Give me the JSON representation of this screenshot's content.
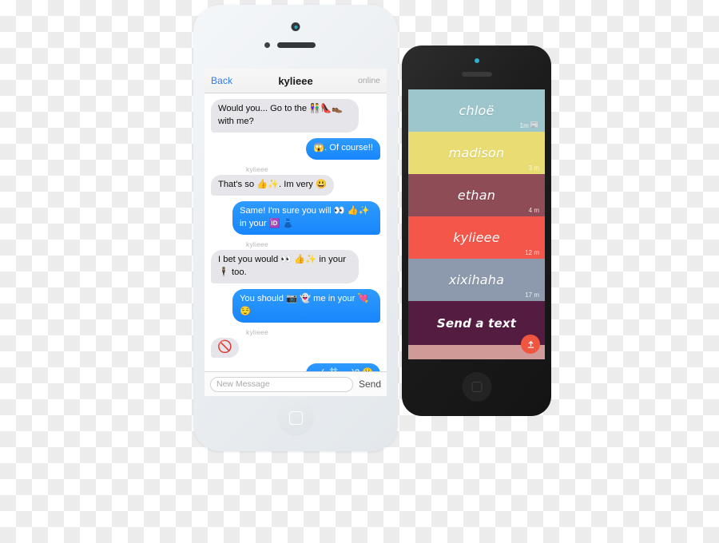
{
  "left_phone": {
    "device": "white-iphone",
    "chat": {
      "back_label": "Back",
      "title": "kylieee",
      "status": "online",
      "messages": [
        {
          "side": "left",
          "sender": "",
          "text": "Would you... Go to the 👫👠👞 with me?"
        },
        {
          "side": "right",
          "sender": "",
          "text": "😱. Of course!!"
        },
        {
          "side": "left",
          "sender": "kylieee",
          "text": "That's so 👍✨. Im very 😃"
        },
        {
          "side": "right",
          "sender": "",
          "text": "Same! I'm sure you will 👀 👍✨ in your 🆔 👗"
        },
        {
          "side": "left",
          "sender": "kylieee",
          "text": "I bet you would 👀 👍✨ in your 🕴 too."
        },
        {
          "side": "right",
          "sender": "",
          "text": "You should 📷 👻 me in your 💘 😌"
        },
        {
          "side": "left",
          "sender": "kylieee",
          "text": "🚫",
          "emoji_only": true
        },
        {
          "side": "right",
          "sender": "",
          "text": "လ(ဝ益ဝလ)? 😩"
        }
      ]
    },
    "composer": {
      "placeholder": "New Message",
      "value": "",
      "send_label": "Send"
    }
  },
  "right_phone": {
    "device": "black-iphone",
    "contacts": [
      {
        "name": "chloë",
        "time": "1m",
        "badge": "📰",
        "color": "#9cc6cc"
      },
      {
        "name": "madison",
        "time": "3 m",
        "badge": "",
        "color": "#e8dc72"
      },
      {
        "name": "ethan",
        "time": "4 m",
        "badge": "",
        "color": "#8e4c57"
      },
      {
        "name": "kylieee",
        "time": "12 m",
        "badge": "",
        "color": "#f4574a"
      },
      {
        "name": "xixihaha",
        "time": "17 m",
        "badge": "",
        "color": "#8d99ad"
      }
    ],
    "compose_row": {
      "label": "Send a text",
      "color": "#551c42",
      "upload_icon": "upload-arrow-icon"
    },
    "footer_color": "#cf9a98"
  },
  "colors": {
    "bubble_blue": "#1886fb",
    "bubble_gray": "#e5e5ea",
    "link_blue": "#2b7bf3",
    "accent_orange": "#f0563f"
  }
}
